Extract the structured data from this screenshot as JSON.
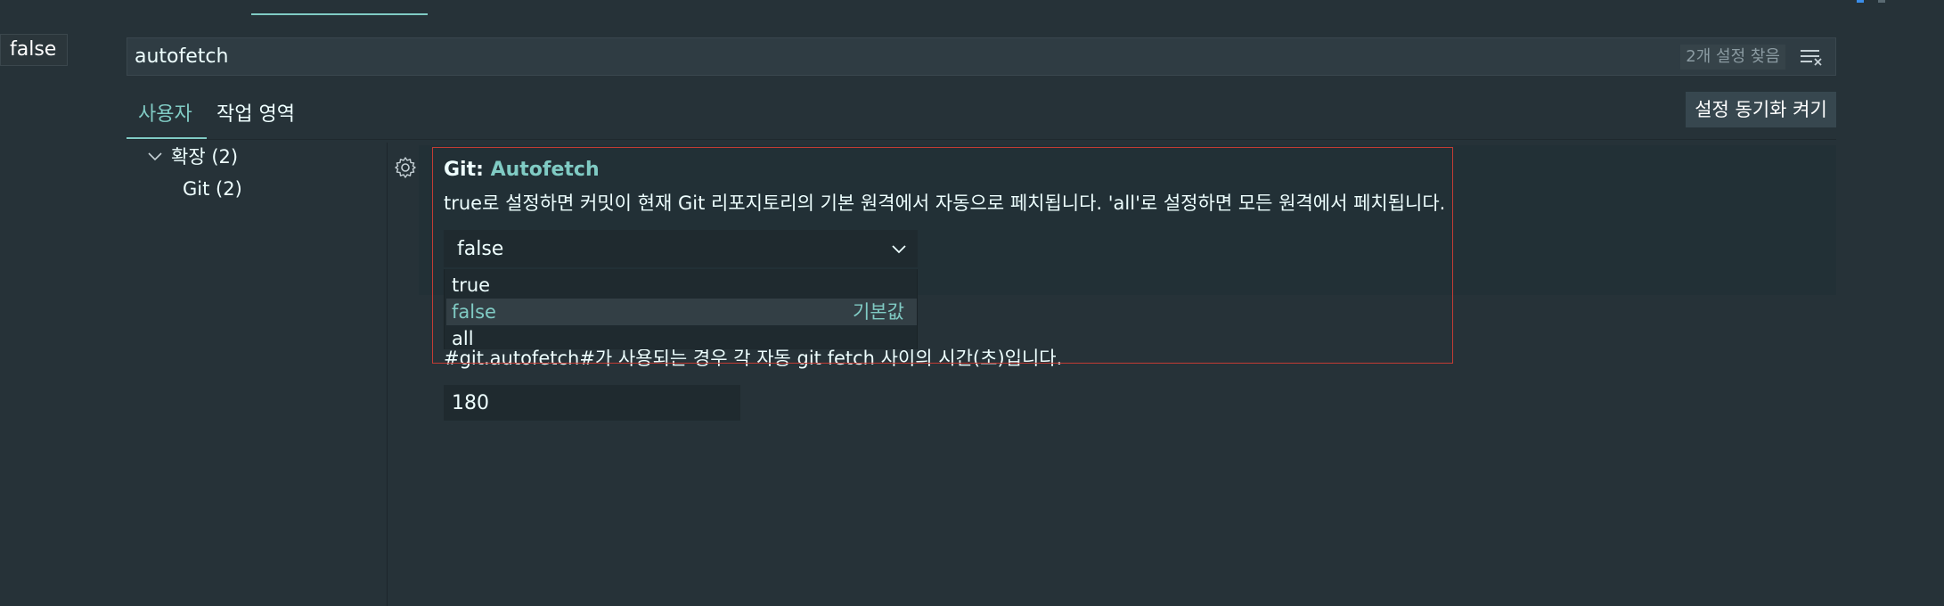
{
  "tooltip": {
    "text": "false"
  },
  "search": {
    "value": "autofetch",
    "result_count": "2개 설정 찾음"
  },
  "tabs": [
    {
      "label": "사용자",
      "active": true
    },
    {
      "label": "작업 영역",
      "active": false
    }
  ],
  "sync_button": {
    "label": "설정 동기화 켜기"
  },
  "toc": {
    "extensions": {
      "label": "확장 (2)"
    },
    "git": {
      "label": "Git (2)"
    }
  },
  "setting_autofetch": {
    "category": "Git: ",
    "name": "Autofetch",
    "description": "true로 설정하면 커밋이 현재 Git 리포지토리의 기본 원격에서 자동으로 페치됩니다. 'all'로 설정하면 모든 원격에서 페치됩니다.",
    "selected": "false",
    "options": [
      "true",
      "false",
      "all"
    ],
    "default_label": "기본값"
  },
  "setting_autofetch_period": {
    "description": "#git.autofetch#가 사용되는 경우 각 자동 git fetch 사이의 시간(초)입니다.",
    "value": "180"
  },
  "colors": {
    "background": "#263238",
    "accent": "#80cbc4",
    "focus_border": "#c23c34",
    "input_background": "#1f2a2f"
  },
  "icons": [
    "clear-filter-icon",
    "chevron-right-icon",
    "gear-icon",
    "chevron-down-icon"
  ]
}
